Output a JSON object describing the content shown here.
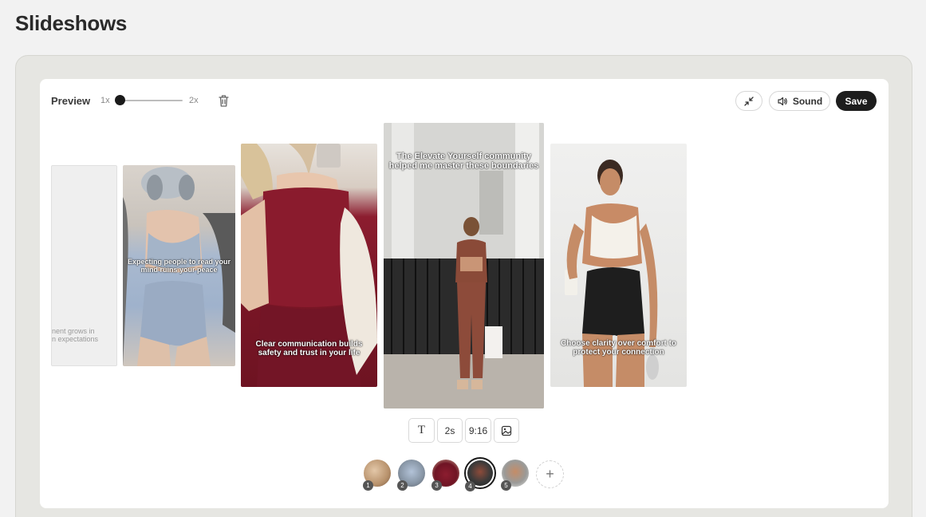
{
  "page": {
    "title": "Slideshows"
  },
  "toolbar": {
    "preview_label": "Preview",
    "zoom_min": "1x",
    "zoom_max": "2x",
    "zoom_level": 0.0,
    "sound_label": "Sound",
    "save_label": "Save"
  },
  "slides": [
    {
      "caption": "nent grows in\nn expectations"
    },
    {
      "caption": "Expecting people to read your mind ruins your peace"
    },
    {
      "caption": "Clear communication builds safety and trust in your life"
    },
    {
      "caption": "The Elevate Yourself community helped me master these boundaries"
    },
    {
      "caption": "Choose clarity over comfort to protect your connection"
    }
  ],
  "slide_tools": {
    "text_label": "T",
    "duration_label": "2s",
    "ratio_label": "9:16"
  },
  "thumbnails": [
    {
      "number": "1"
    },
    {
      "number": "2"
    },
    {
      "number": "3"
    },
    {
      "number": "4"
    },
    {
      "number": "5"
    }
  ],
  "colors": {
    "background": "#f2f2f2",
    "save_button": "#1d1d1d",
    "burgundy": "#7a1626"
  }
}
